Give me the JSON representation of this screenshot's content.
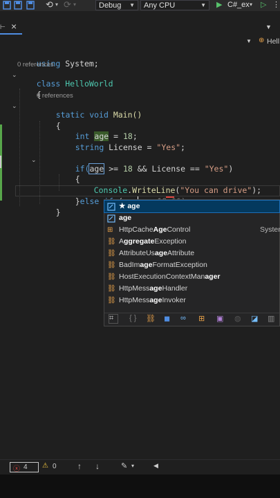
{
  "toolbar": {
    "config": "Debug",
    "platform": "Any CPU",
    "start_target": "C#_ex",
    "colors": {
      "accent": "#4f8de2",
      "run": "#57c26b"
    }
  },
  "tab": {
    "close": "×"
  },
  "navbar": {
    "class_name": "Hell"
  },
  "code": {
    "line1_kw": "using",
    "line1_rest": " System;",
    "refs1": "0 references",
    "line2_kw": "class",
    "line2_rest": " HelloWorld",
    "line3": "{",
    "refs2": "0 references",
    "line4_kw1": "static",
    "line4_kw2": "void",
    "line4_rest": " Main()",
    "line5": "{",
    "line6_kw": "int",
    "line6_var": "age",
    "line6_eq": " = ",
    "line6_num": "18",
    "line6_end": ";",
    "line7_kw": "string",
    "line7_mid": " License = ",
    "line7_str": "\"Yes\"",
    "line7_end": ";",
    "line8_if": "if(",
    "line8_var": "age",
    "line8_mid": " >= ",
    "line8_num": "18",
    "line8_and": " && License == ",
    "line8_str": "\"Yes\"",
    "line8_end": ")",
    "line9": "{",
    "line10_cls": "Console",
    "line10_dot": ".",
    "line10_fn": "WriteLine",
    "line10_open": "(",
    "line10_str": "\"You can drive\"",
    "line10_end": ");",
    "line11_brace": "}",
    "line11_else": "else if",
    "line11_open": " (",
    "line11_typed": "age",
    "line11_ghost": " >= 18 &&)",
    "line12": "}"
  },
  "completion": {
    "items": [
      {
        "label": "★ age",
        "bold": "",
        "rest": ""
      },
      {
        "label": "age",
        "bold": "",
        "rest": ""
      },
      {
        "pre": "HttpCache",
        "bold": "Age",
        "rest": "Control",
        "extra": "Systen"
      },
      {
        "pre": "A",
        "bold": "ggregate",
        "rest": "Exception"
      },
      {
        "pre": "AttributeUs",
        "bold": "age",
        "rest": "Attribute"
      },
      {
        "pre": "BadIm",
        "bold": "age",
        "rest": "FormatException"
      },
      {
        "pre": "HostExecutionContextMan",
        "bold": "ager",
        "rest": ""
      },
      {
        "pre": "HttpMess",
        "bold": "age",
        "rest": "Handler"
      },
      {
        "pre": "HttpMess",
        "bold": "age",
        "rest": "Invoker"
      }
    ]
  },
  "status": {
    "errors": "4",
    "warnings": "0"
  }
}
